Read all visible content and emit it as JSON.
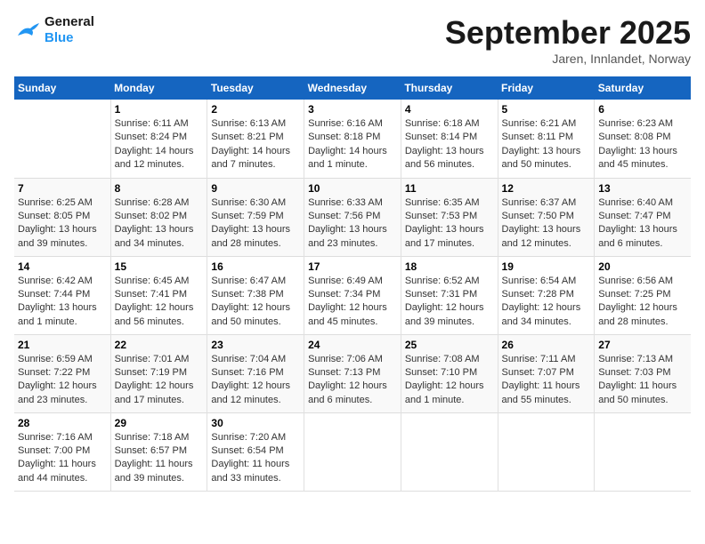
{
  "header": {
    "logo_line1": "General",
    "logo_line2": "Blue",
    "month": "September 2025",
    "location": "Jaren, Innlandet, Norway"
  },
  "days_of_week": [
    "Sunday",
    "Monday",
    "Tuesday",
    "Wednesday",
    "Thursday",
    "Friday",
    "Saturday"
  ],
  "weeks": [
    [
      {
        "day": "",
        "content": ""
      },
      {
        "day": "1",
        "content": "Sunrise: 6:11 AM\nSunset: 8:24 PM\nDaylight: 14 hours\nand 12 minutes."
      },
      {
        "day": "2",
        "content": "Sunrise: 6:13 AM\nSunset: 8:21 PM\nDaylight: 14 hours\nand 7 minutes."
      },
      {
        "day": "3",
        "content": "Sunrise: 6:16 AM\nSunset: 8:18 PM\nDaylight: 14 hours\nand 1 minute."
      },
      {
        "day": "4",
        "content": "Sunrise: 6:18 AM\nSunset: 8:14 PM\nDaylight: 13 hours\nand 56 minutes."
      },
      {
        "day": "5",
        "content": "Sunrise: 6:21 AM\nSunset: 8:11 PM\nDaylight: 13 hours\nand 50 minutes."
      },
      {
        "day": "6",
        "content": "Sunrise: 6:23 AM\nSunset: 8:08 PM\nDaylight: 13 hours\nand 45 minutes."
      }
    ],
    [
      {
        "day": "7",
        "content": "Sunrise: 6:25 AM\nSunset: 8:05 PM\nDaylight: 13 hours\nand 39 minutes."
      },
      {
        "day": "8",
        "content": "Sunrise: 6:28 AM\nSunset: 8:02 PM\nDaylight: 13 hours\nand 34 minutes."
      },
      {
        "day": "9",
        "content": "Sunrise: 6:30 AM\nSunset: 7:59 PM\nDaylight: 13 hours\nand 28 minutes."
      },
      {
        "day": "10",
        "content": "Sunrise: 6:33 AM\nSunset: 7:56 PM\nDaylight: 13 hours\nand 23 minutes."
      },
      {
        "day": "11",
        "content": "Sunrise: 6:35 AM\nSunset: 7:53 PM\nDaylight: 13 hours\nand 17 minutes."
      },
      {
        "day": "12",
        "content": "Sunrise: 6:37 AM\nSunset: 7:50 PM\nDaylight: 13 hours\nand 12 minutes."
      },
      {
        "day": "13",
        "content": "Sunrise: 6:40 AM\nSunset: 7:47 PM\nDaylight: 13 hours\nand 6 minutes."
      }
    ],
    [
      {
        "day": "14",
        "content": "Sunrise: 6:42 AM\nSunset: 7:44 PM\nDaylight: 13 hours\nand 1 minute."
      },
      {
        "day": "15",
        "content": "Sunrise: 6:45 AM\nSunset: 7:41 PM\nDaylight: 12 hours\nand 56 minutes."
      },
      {
        "day": "16",
        "content": "Sunrise: 6:47 AM\nSunset: 7:38 PM\nDaylight: 12 hours\nand 50 minutes."
      },
      {
        "day": "17",
        "content": "Sunrise: 6:49 AM\nSunset: 7:34 PM\nDaylight: 12 hours\nand 45 minutes."
      },
      {
        "day": "18",
        "content": "Sunrise: 6:52 AM\nSunset: 7:31 PM\nDaylight: 12 hours\nand 39 minutes."
      },
      {
        "day": "19",
        "content": "Sunrise: 6:54 AM\nSunset: 7:28 PM\nDaylight: 12 hours\nand 34 minutes."
      },
      {
        "day": "20",
        "content": "Sunrise: 6:56 AM\nSunset: 7:25 PM\nDaylight: 12 hours\nand 28 minutes."
      }
    ],
    [
      {
        "day": "21",
        "content": "Sunrise: 6:59 AM\nSunset: 7:22 PM\nDaylight: 12 hours\nand 23 minutes."
      },
      {
        "day": "22",
        "content": "Sunrise: 7:01 AM\nSunset: 7:19 PM\nDaylight: 12 hours\nand 17 minutes."
      },
      {
        "day": "23",
        "content": "Sunrise: 7:04 AM\nSunset: 7:16 PM\nDaylight: 12 hours\nand 12 minutes."
      },
      {
        "day": "24",
        "content": "Sunrise: 7:06 AM\nSunset: 7:13 PM\nDaylight: 12 hours\nand 6 minutes."
      },
      {
        "day": "25",
        "content": "Sunrise: 7:08 AM\nSunset: 7:10 PM\nDaylight: 12 hours\nand 1 minute."
      },
      {
        "day": "26",
        "content": "Sunrise: 7:11 AM\nSunset: 7:07 PM\nDaylight: 11 hours\nand 55 minutes."
      },
      {
        "day": "27",
        "content": "Sunrise: 7:13 AM\nSunset: 7:03 PM\nDaylight: 11 hours\nand 50 minutes."
      }
    ],
    [
      {
        "day": "28",
        "content": "Sunrise: 7:16 AM\nSunset: 7:00 PM\nDaylight: 11 hours\nand 44 minutes."
      },
      {
        "day": "29",
        "content": "Sunrise: 7:18 AM\nSunset: 6:57 PM\nDaylight: 11 hours\nand 39 minutes."
      },
      {
        "day": "30",
        "content": "Sunrise: 7:20 AM\nSunset: 6:54 PM\nDaylight: 11 hours\nand 33 minutes."
      },
      {
        "day": "",
        "content": ""
      },
      {
        "day": "",
        "content": ""
      },
      {
        "day": "",
        "content": ""
      },
      {
        "day": "",
        "content": ""
      }
    ]
  ]
}
